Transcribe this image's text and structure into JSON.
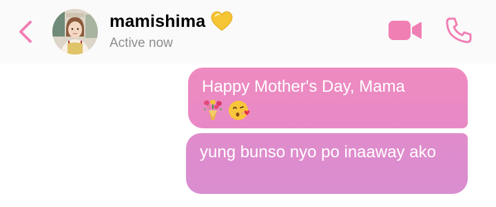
{
  "header": {
    "contact_name": "mamishima",
    "status": "Active now",
    "name_icon": "yellow-heart-icon",
    "back_icon": "chevron-left-icon",
    "video_icon": "video-camera-icon",
    "phone_icon": "phone-icon",
    "accent_color": "#f07fb4"
  },
  "messages": [
    {
      "text": "Happy Mother's Day, Mama",
      "emojis": [
        "bouquet-icon",
        "kissing-face-icon"
      ],
      "bubble_color": "#ec8ac2"
    },
    {
      "text": "yung bunso nyo po inaaway ako",
      "emojis": [],
      "bubble_color": "#dd8ccd"
    }
  ]
}
